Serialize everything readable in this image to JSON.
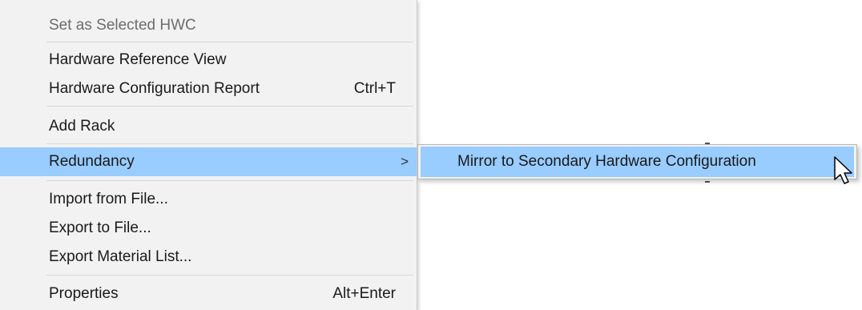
{
  "menu": {
    "items": [
      {
        "label": "Set as Selected HWC",
        "shortcut": "",
        "disabled": true
      },
      {
        "label": "Hardware Reference View",
        "shortcut": ""
      },
      {
        "label": "Hardware Configuration Report",
        "shortcut": "Ctrl+T"
      },
      {
        "label": "Add Rack",
        "shortcut": ""
      },
      {
        "label": "Redundancy",
        "shortcut": "",
        "submenu_arrow": ">",
        "highlighted": true
      },
      {
        "label": "Import from File...",
        "shortcut": ""
      },
      {
        "label": "Export to File...",
        "shortcut": ""
      },
      {
        "label": "Export Material List...",
        "shortcut": ""
      },
      {
        "label": "Properties",
        "shortcut": "Alt+Enter"
      }
    ]
  },
  "submenu": {
    "items": [
      {
        "label": "Mirror to Secondary Hardware Configuration",
        "highlighted": true
      }
    ]
  },
  "colors": {
    "menu_background": "#f2f2f2",
    "highlight": "#99ccff",
    "disabled_text": "#6d6d6d",
    "text": "#1a1a1a"
  },
  "icons": {
    "cursor": "arrow-pointer-icon"
  }
}
